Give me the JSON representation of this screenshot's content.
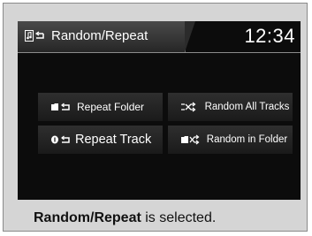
{
  "header": {
    "title": "Random/Repeat",
    "clock": "12:34"
  },
  "options": [
    {
      "label": "Repeat Folder",
      "icon": "repeat-folder-icon"
    },
    {
      "label": "Random All Tracks",
      "icon": "random-all-icon"
    },
    {
      "label": "Repeat Track",
      "icon": "repeat-track-icon"
    },
    {
      "label": "Random in Folder",
      "icon": "random-folder-icon"
    }
  ],
  "caption": {
    "bold": "Random/Repeat",
    "rest": " is selected."
  },
  "colors": {
    "screen_bg": "#0c0c0c",
    "frame_bg": "#d5d5d5",
    "text": "#ffffff"
  }
}
